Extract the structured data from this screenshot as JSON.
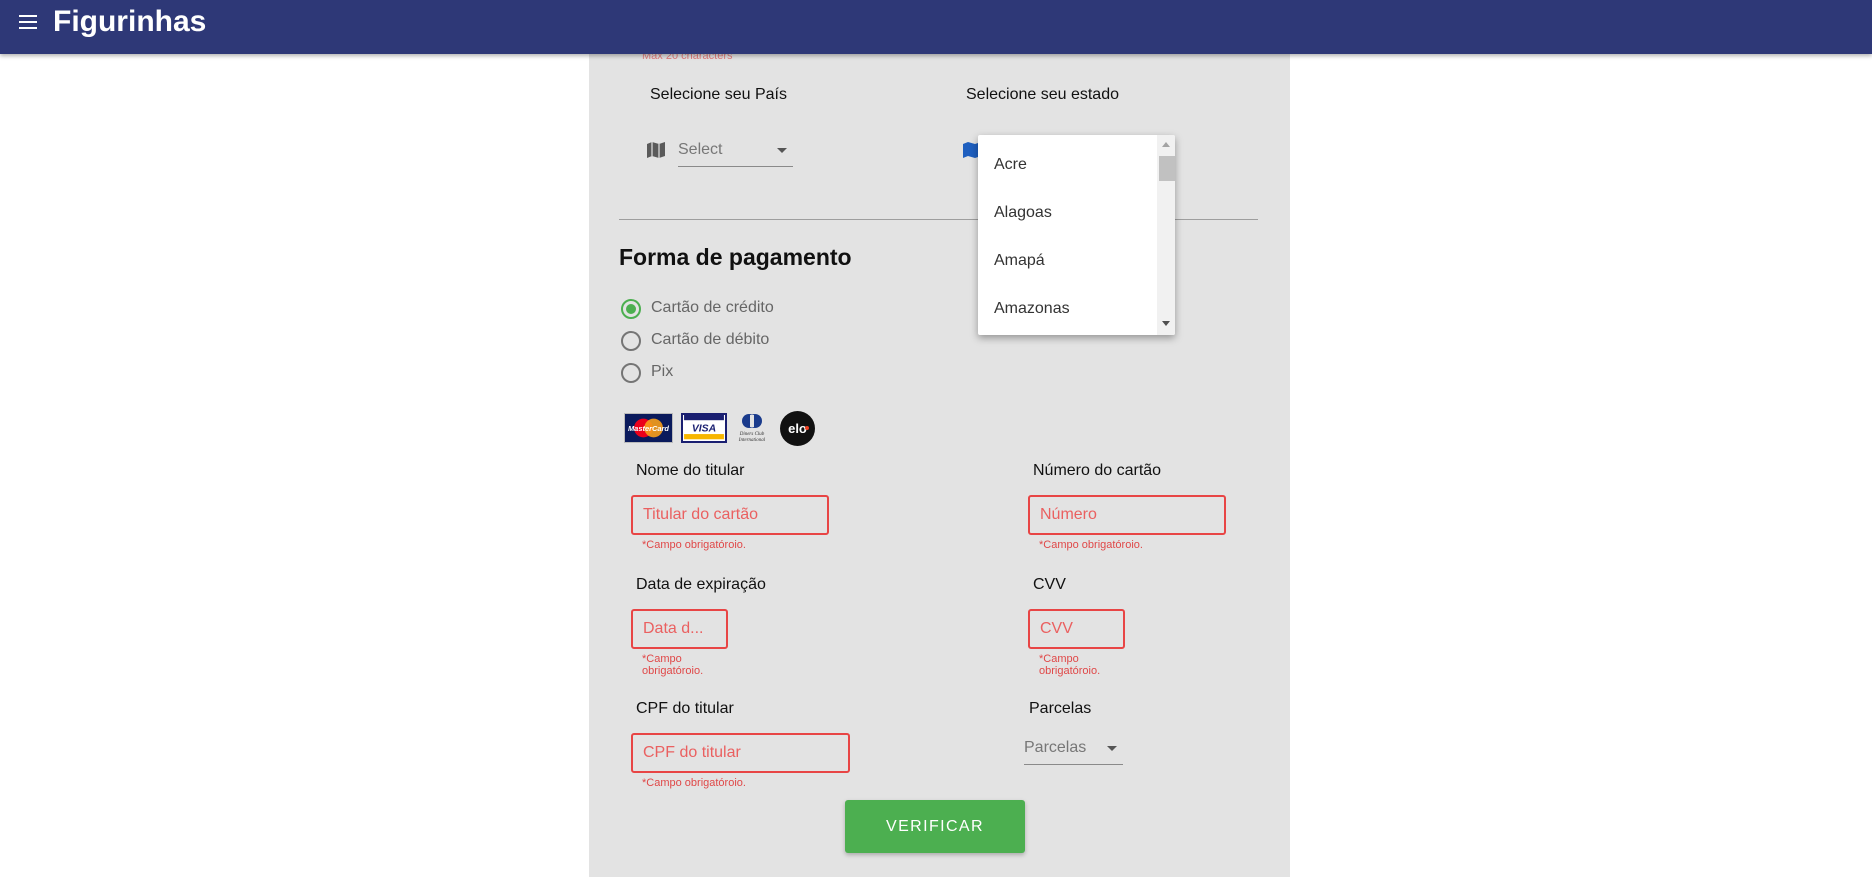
{
  "app": {
    "title": "Figurinhas",
    "menu_icon": "menu-icon"
  },
  "top_hint": "Max 20 characters",
  "location": {
    "country_label": "Selecione seu País",
    "country_select_value": "Select",
    "state_label": "Selecione seu estado",
    "state_options_visible": [
      "Acre",
      "Alagoas",
      "Amapá",
      "Amazonas"
    ]
  },
  "payment": {
    "title": "Forma de pagamento",
    "methods": [
      {
        "label": "Cartão de crédito",
        "checked": true
      },
      {
        "label": "Cartão de débito",
        "checked": false
      },
      {
        "label": "Pix",
        "checked": false
      }
    ],
    "card_brands": [
      "MasterCard",
      "VISA",
      "Diners Club International",
      "elo"
    ],
    "diners_text": {
      "line1": "Diners Club",
      "line2": "International"
    }
  },
  "form": {
    "holder_label": "Nome do titular",
    "holder_placeholder": "Titular do cartão",
    "number_label": "Número do cartão",
    "number_placeholder": "Número",
    "expiry_label": "Data de expiração",
    "expiry_placeholder": "Data d...",
    "cvv_label": "CVV",
    "cvv_placeholder": "CVV",
    "cpf_label": "CPF do titular",
    "cpf_placeholder": "CPF do titular",
    "installments_label": "Parcelas",
    "installments_value": "Parcelas",
    "required_error": "*Campo obrigatóroio.",
    "required_error_line1": "*Campo",
    "required_error_line2": "obrigatóroio."
  },
  "submit_label": "VERIFICAR",
  "colors": {
    "appbar": "#2e3877",
    "panel": "#e3e3e3",
    "error": "#e84545",
    "success": "#4caf50"
  }
}
